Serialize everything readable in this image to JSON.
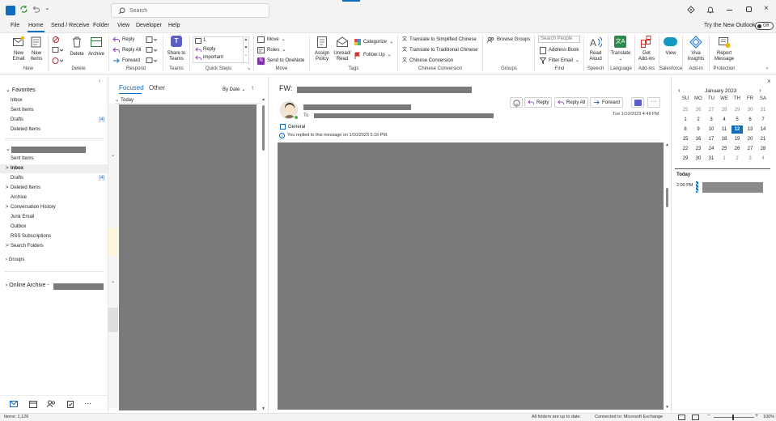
{
  "titlebar": {
    "search_placeholder": "Search",
    "try_new_outlook": "Try the New Outlook",
    "toggle_state": "Off"
  },
  "menu": {
    "items": [
      "File",
      "Home",
      "Send / Receive",
      "Folder",
      "View",
      "Developer",
      "Help"
    ],
    "active": "Home"
  },
  "ribbon": {
    "new_email": "New\nEmail",
    "new_items": "New\nItems",
    "delete": "Delete",
    "archive": "Archive",
    "reply": "Reply",
    "reply_all": "Reply All",
    "forward": "Forward",
    "share_to_teams": "Share to\nTeams",
    "quick_step_1": "1",
    "quick_step_reply": "Reply",
    "quick_step_important": "important",
    "move": "Move",
    "rules": "Rules",
    "send_to_onenote": "Send to OneNote",
    "assign_policy": "Assign\nPolicy",
    "unread_read": "Unread/\nRead",
    "categorize": "Categorize",
    "follow_up": "Follow Up",
    "translate_simplified": "Translate to Simplified Chinese",
    "translate_traditional": "Translate to Traditional Chinese",
    "chinese_conversion": "Chinese Conversion",
    "browse_groups": "Browse Groups",
    "search_people": "Search People",
    "address_book": "Address Book",
    "filter_email": "Filter Email",
    "read_aloud": "Read\nAloud",
    "translate": "Translate",
    "get_addins": "Get\nAdd-ins",
    "view": "View",
    "viva_insights": "Viva\nInsights",
    "report_message": "Report\nMessage",
    "groups": {
      "new": "New",
      "delete": "Delete",
      "respond": "Respond",
      "teams": "Teams",
      "quick_steps": "Quick Steps",
      "move": "Move",
      "tags": "Tags",
      "chinese_conversion": "Chinese Conversion",
      "groups": "Groups",
      "find": "Find",
      "speech": "Speech",
      "language": "Language",
      "addins": "Add-ins",
      "salesforce": "Salesforce",
      "addin": "Add-in",
      "protection": "Protection"
    }
  },
  "folders": {
    "favorites_title": "Favorites",
    "favorites": [
      {
        "label": "Inbox",
        "count": ""
      },
      {
        "label": "Sent Items",
        "count": ""
      },
      {
        "label": "Drafts",
        "count": "[4]"
      },
      {
        "label": "Deleted Items",
        "count": ""
      }
    ],
    "account": [
      {
        "label": "Sent Items",
        "count": "",
        "prefix": ""
      },
      {
        "label": "Inbox",
        "count": "",
        "prefix": ">"
      },
      {
        "label": "Drafts",
        "count": "[4]",
        "prefix": ""
      },
      {
        "label": "Deleted Items",
        "count": "",
        "prefix": ">"
      },
      {
        "label": "Archive",
        "count": "",
        "prefix": ""
      },
      {
        "label": "Conversation History",
        "count": "",
        "prefix": ">"
      },
      {
        "label": "Junk Email",
        "count": "",
        "prefix": ""
      },
      {
        "label": "Outbox",
        "count": "",
        "prefix": ""
      },
      {
        "label": "RSS Subscriptions",
        "count": "",
        "prefix": ""
      },
      {
        "label": "Search Folders",
        "count": "",
        "prefix": ">"
      }
    ],
    "groups_label": "Groups",
    "online_archive": "Online Archive -"
  },
  "list": {
    "tab_focused": "Focused",
    "tab_other": "Other",
    "sort": "By Date",
    "today": "Today"
  },
  "reading": {
    "subject_prefix": "FW:",
    "to_label": "To",
    "category": "General",
    "replied_note": "You replied to this message on 1/10/2023 5:16 PM.",
    "date": "Tue 1/10/2023 4:49 PM",
    "reply": "Reply",
    "reply_all": "Reply All",
    "forward": "Forward"
  },
  "calendar": {
    "month": "January 2023",
    "weekdays": [
      "SU",
      "MO",
      "TU",
      "WE",
      "TH",
      "FR",
      "SA"
    ],
    "weeks": [
      [
        "25",
        "26",
        "27",
        "28",
        "29",
        "30",
        "31"
      ],
      [
        "1",
        "2",
        "3",
        "4",
        "5",
        "6",
        "7"
      ],
      [
        "8",
        "9",
        "10",
        "11",
        "12",
        "13",
        "14"
      ],
      [
        "15",
        "16",
        "17",
        "18",
        "19",
        "20",
        "21"
      ],
      [
        "22",
        "23",
        "24",
        "25",
        "26",
        "27",
        "28"
      ],
      [
        "29",
        "30",
        "31",
        "1",
        "2",
        "3",
        "4"
      ]
    ],
    "selected": "12",
    "today_label": "Today",
    "event_time": "2:00 PM"
  },
  "status": {
    "items": "Items: 1,126",
    "up_to_date": "All folders are up to date.",
    "connected": "Connected to: Microsoft Exchange",
    "zoom": "100%"
  },
  "colors": {
    "accent": "#0f6cbd",
    "redaction": "#7a7a7a",
    "selected_day": "#0f6cbd"
  }
}
